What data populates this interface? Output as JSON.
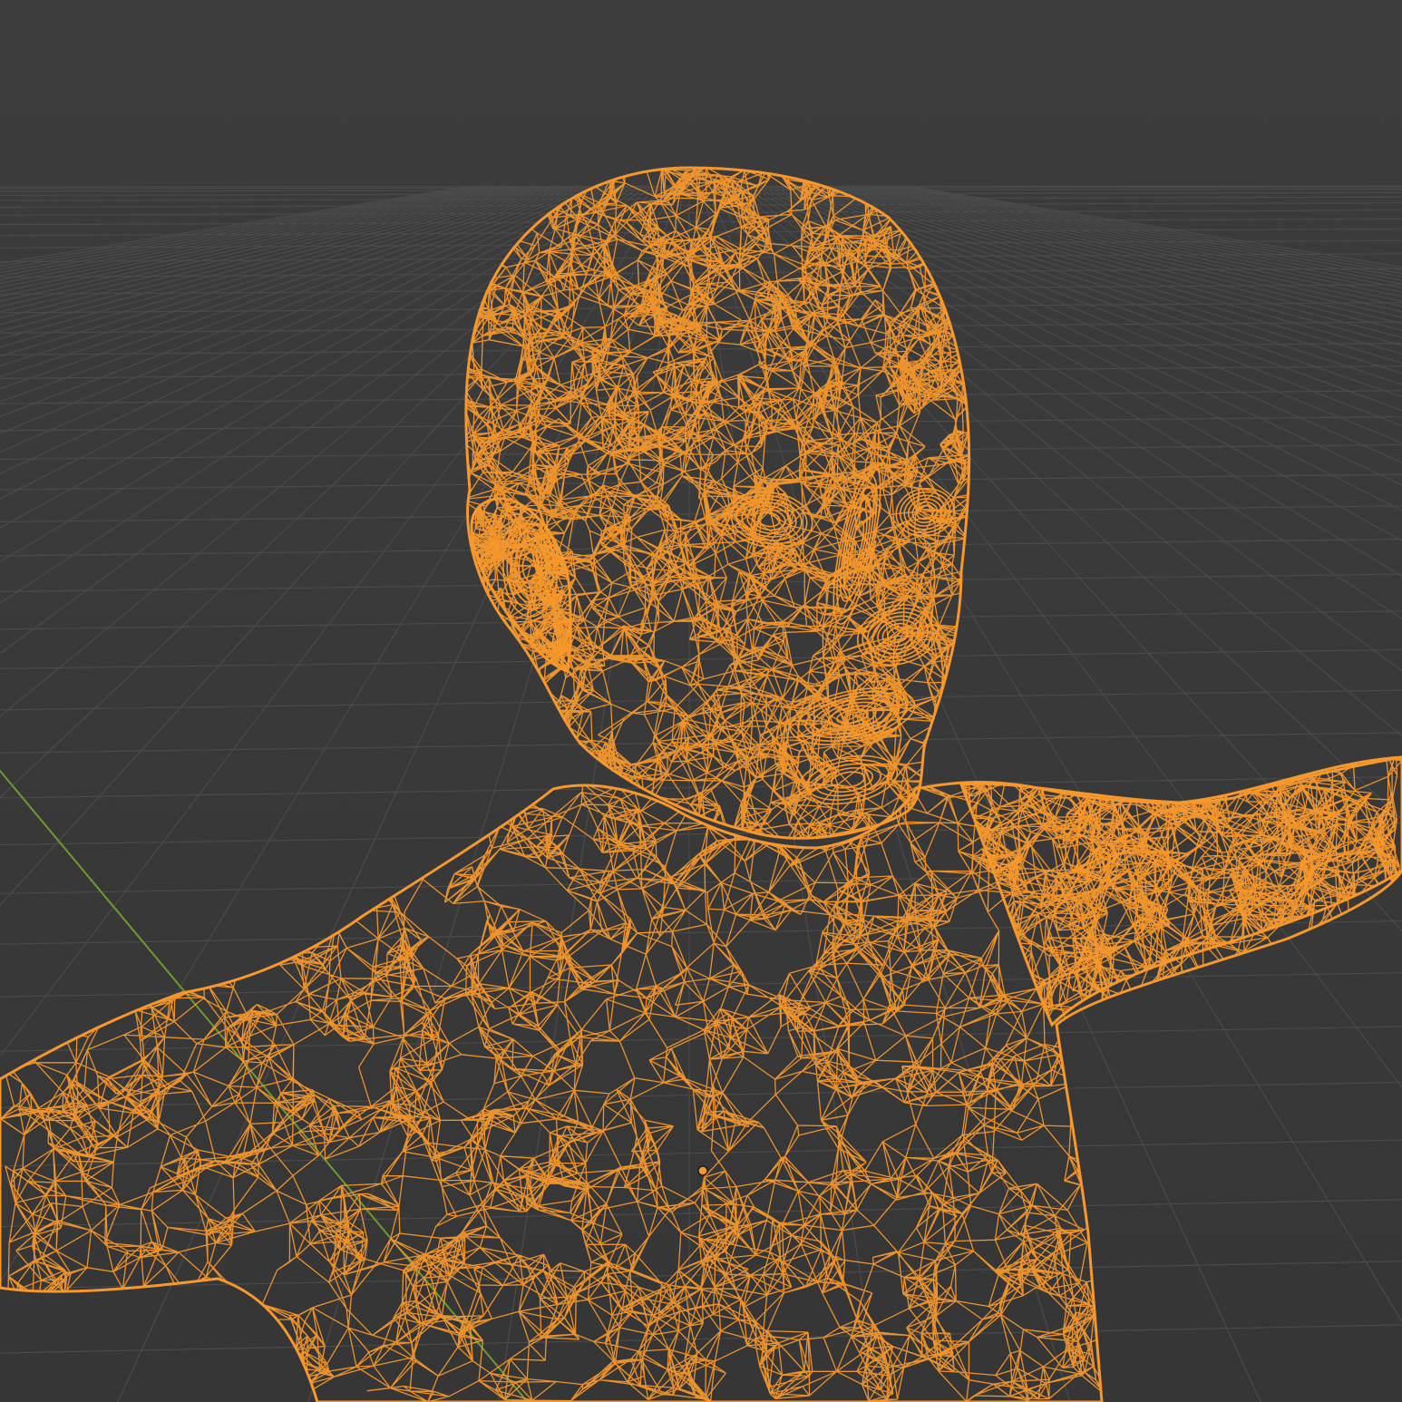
{
  "viewport": {
    "view": "3d-viewport",
    "shading_mode": "wireframe",
    "object_selected": true
  },
  "colors": {
    "background_top": "#3c3c3c",
    "background_bottom": "#363636",
    "grid_line": "#4b4b4b",
    "y_axis": "#6f9a32",
    "selected_wire": "#f7982c",
    "selected_wire_dim": "#c9771f",
    "origin_fill": "#f7982c",
    "origin_outline": "#1e1e1e"
  },
  "icons": {
    "object_origin": "origin-dot-icon"
  }
}
